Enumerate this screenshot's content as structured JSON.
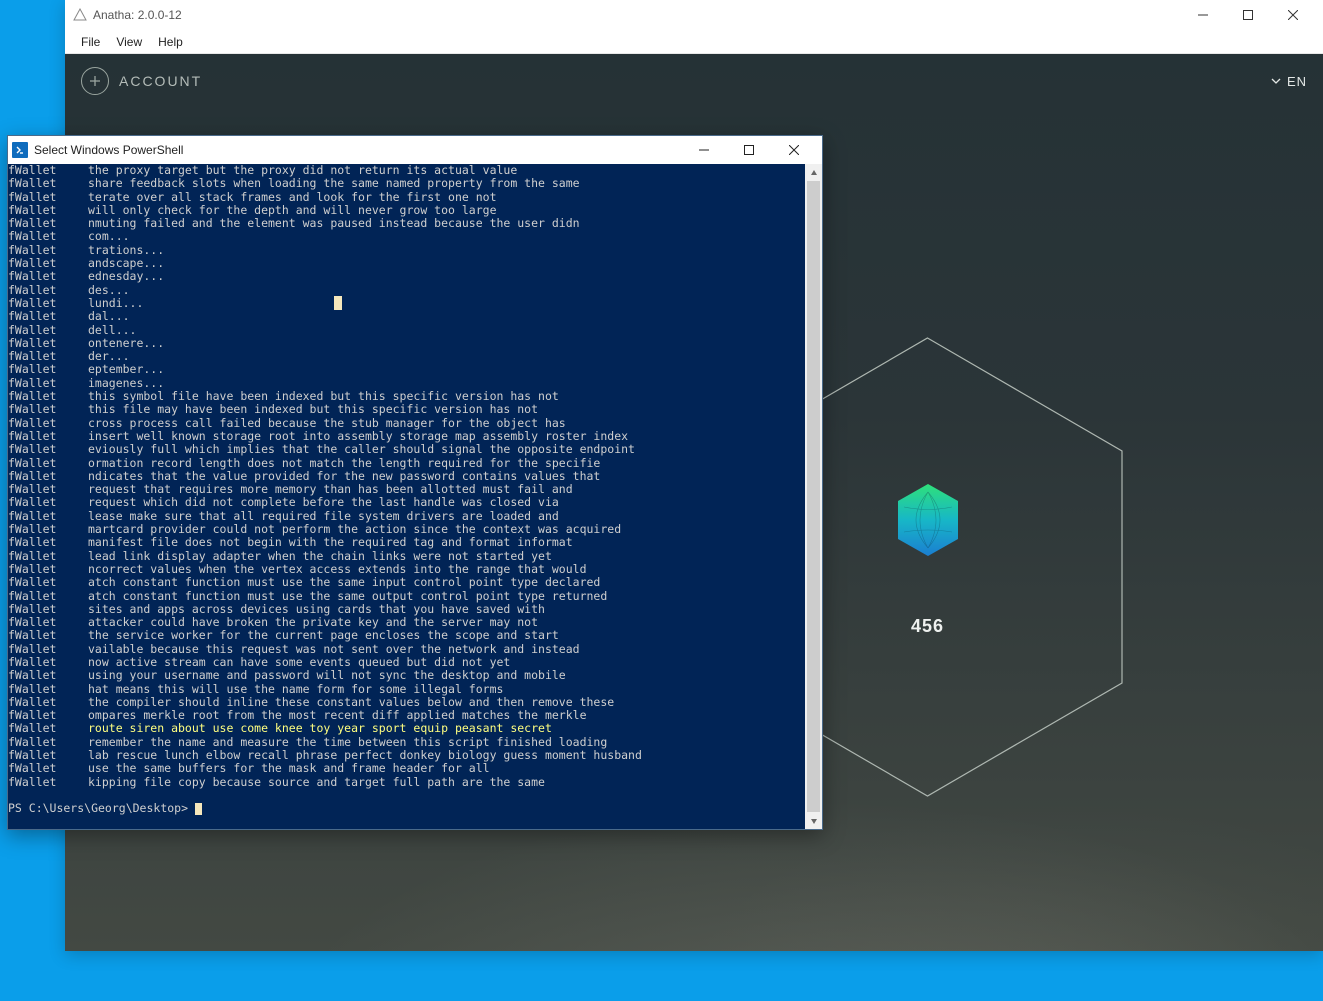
{
  "anatha": {
    "title": "Anatha: 2.0.0-12",
    "menu": {
      "file": "File",
      "view": "View",
      "help": "Help"
    },
    "account_label": "ACCOUNT",
    "lang_label": "EN",
    "hex_value": "456"
  },
  "powershell": {
    "title": "Select Windows PowerShell",
    "prompt": "PS C:\\Users\\Georg\\Desktop> ",
    "row_label": "fWallet",
    "highlight_index": 42,
    "lines": [
      "the proxy target but the proxy did not return its actual value",
      "share feedback slots when loading the same named property from the same",
      "terate over all stack frames and look for the first one not",
      "will only check for the depth and will never grow too large",
      "nmuting failed and the element was paused instead because the user didn",
      "com...",
      "trations...",
      "andscape...",
      "ednesday...",
      "des...",
      "lundi...",
      "dal...",
      "dell...",
      "ontenere...",
      "der...",
      "eptember...",
      "imagenes...",
      "this symbol file have been indexed but this specific version has not",
      "this file may have been indexed but this specific version has not",
      "cross process call failed because the stub manager for the object has",
      "insert well known storage root into assembly storage map assembly roster index",
      "eviously full which implies that the caller should signal the opposite endpoint",
      "ormation record length does not match the length required for the specifie",
      "ndicates that the value provided for the new password contains values that",
      "request that requires more memory than has been allotted must fail and",
      "request which did not complete before the last handle was closed via",
      "lease make sure that all required file system drivers are loaded and",
      "martcard provider could not perform the action since the context was acquired",
      "manifest file does not begin with the required tag and format informat",
      "lead link display adapter when the chain links were not started yet",
      "ncorrect values when the vertex access extends into the range that would",
      "atch constant function must use the same input control point type declared",
      "atch constant function must use the same output control point type returned",
      "sites and apps across devices using cards that you have saved with",
      "attacker could have broken the private key and the server may not",
      "the service worker for the current page encloses the scope and start",
      "vailable because this request was not sent over the network and instead",
      "now active stream can have some events queued but did not yet",
      "using your username and password will not sync the desktop and mobile",
      "hat means this will use the name form for some illegal forms",
      "the compiler should inline these constant values below and then remove these",
      "ompares merkle root from the most recent diff applied matches the merkle",
      "route siren about use come knee toy year sport equip peasant secret",
      "remember the name and measure the time between this script finished loading",
      "lab rescue lunch elbow recall phrase perfect donkey biology guess moment husband",
      "use the same buffers for the mask and frame header for all",
      "kipping file copy because source and target full path are the same"
    ]
  }
}
